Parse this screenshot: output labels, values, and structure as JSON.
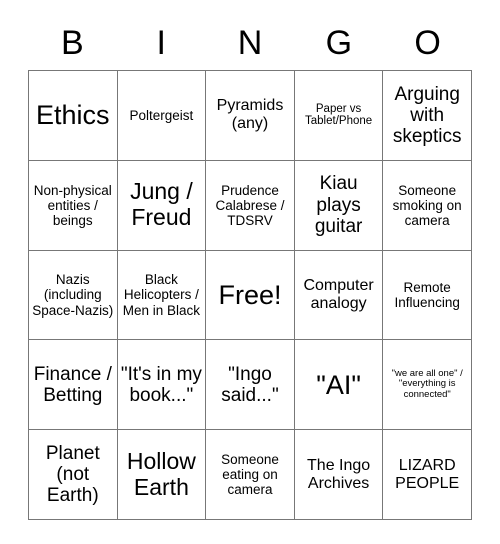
{
  "card": {
    "header_letters": [
      "B",
      "I",
      "N",
      "G",
      "O"
    ],
    "grid_line_color": "#777777",
    "text_color": "#000000",
    "background_color": "#ffffff",
    "rows": [
      [
        {
          "text": "Ethics",
          "size": "xxl"
        },
        {
          "text": "Poltergeist",
          "size": "sm"
        },
        {
          "text": "Pyramids (any)",
          "size": "md"
        },
        {
          "text": "Paper vs Tablet/Phone",
          "size": "xs"
        },
        {
          "text": "Arguing with skeptics",
          "size": "lg"
        }
      ],
      [
        {
          "text": "Non-physical entities / beings",
          "size": "sm"
        },
        {
          "text": "Jung / Freud",
          "size": "xl"
        },
        {
          "text": "Prudence Calabrese / TDSRV",
          "size": "sm"
        },
        {
          "text": "Kiau plays guitar",
          "size": "lg"
        },
        {
          "text": "Someone smoking on camera",
          "size": "sm"
        }
      ],
      [
        {
          "text": "Nazis (including Space-Nazis)",
          "size": "sm"
        },
        {
          "text": "Black Helicopters / Men in Black",
          "size": "sm"
        },
        {
          "text": "Free!",
          "size": "xxl"
        },
        {
          "text": "Computer analogy",
          "size": "md"
        },
        {
          "text": "Remote Influencing",
          "size": "sm"
        }
      ],
      [
        {
          "text": "Finance / Betting",
          "size": "lg"
        },
        {
          "text": "\"It's in my book...\"",
          "size": "lg"
        },
        {
          "text": "\"Ingo said...\"",
          "size": "lg"
        },
        {
          "text": "\"AI\"",
          "size": "xxl"
        },
        {
          "text": "\"we are all one\" / \"everything is connected\"",
          "size": "xxs"
        }
      ],
      [
        {
          "text": "Planet (not Earth)",
          "size": "lg"
        },
        {
          "text": "Hollow Earth",
          "size": "xl"
        },
        {
          "text": "Someone eating on camera",
          "size": "sm"
        },
        {
          "text": "The Ingo Archives",
          "size": "md"
        },
        {
          "text": "LIZARD PEOPLE",
          "size": "md"
        }
      ]
    ]
  }
}
